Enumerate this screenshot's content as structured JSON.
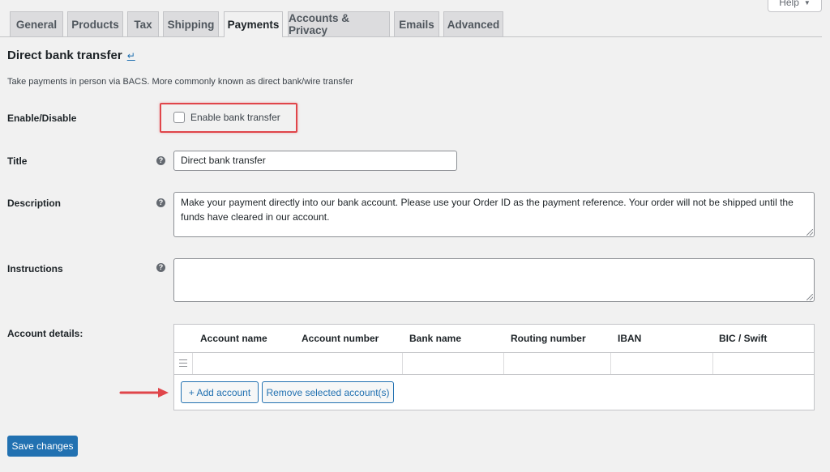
{
  "help": {
    "label": "Help",
    "icon": "caret-down-icon"
  },
  "tabs": [
    {
      "label": "General"
    },
    {
      "label": "Products"
    },
    {
      "label": "Tax"
    },
    {
      "label": "Shipping"
    },
    {
      "label": "Payments",
      "active": true
    },
    {
      "label": "Accounts & Privacy"
    },
    {
      "label": "Emails"
    },
    {
      "label": "Advanced"
    }
  ],
  "section": {
    "title": "Direct bank transfer",
    "return_icon": "↵",
    "description": "Take payments in person via BACS. More commonly known as direct bank/wire transfer"
  },
  "fields": {
    "enable": {
      "label": "Enable/Disable",
      "checkbox_label": "Enable bank transfer",
      "checked": false
    },
    "title": {
      "label": "Title",
      "value": "Direct bank transfer"
    },
    "description": {
      "label": "Description",
      "value": "Make your payment directly into our bank account. Please use your Order ID as the payment reference. Your order will not be shipped until the funds have cleared in our account."
    },
    "instructions": {
      "label": "Instructions",
      "value": ""
    },
    "account_details": {
      "label": "Account details:"
    }
  },
  "accounts": {
    "columns": [
      "Account name",
      "Account number",
      "Bank name",
      "Routing number",
      "IBAN",
      "BIC / Swift"
    ],
    "add_label": "+ Add account",
    "remove_label": "Remove selected account(s)"
  },
  "save_label": "Save changes",
  "colors": {
    "accent": "#2271b1",
    "highlight": "#e0454a"
  }
}
